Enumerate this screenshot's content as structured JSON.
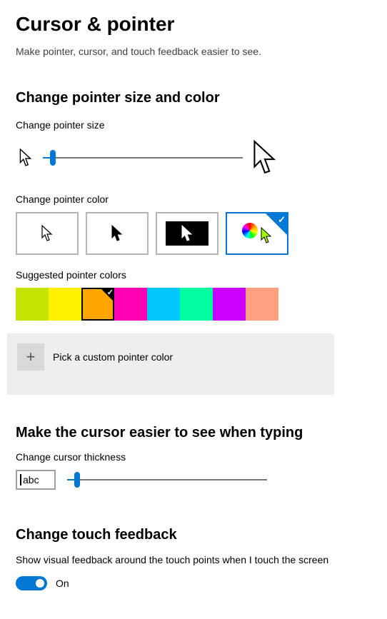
{
  "header": {
    "title": "Cursor & pointer",
    "subtitle": "Make pointer, cursor, and touch feedback easier to see."
  },
  "pointer_size_section": {
    "heading": "Change pointer size and color",
    "size_label": "Change pointer size",
    "slider_fill_percent": 5
  },
  "pointer_color": {
    "label": "Change pointer color",
    "options": [
      {
        "id": "white",
        "selected": false
      },
      {
        "id": "black",
        "selected": false
      },
      {
        "id": "inverted",
        "selected": false
      },
      {
        "id": "custom",
        "selected": true
      }
    ]
  },
  "suggested_colors": {
    "label": "Suggested pointer colors",
    "swatches": [
      {
        "hex": "#c4e400",
        "selected": false
      },
      {
        "hex": "#fff000",
        "selected": false
      },
      {
        "hex": "#ffa500",
        "selected": true
      },
      {
        "hex": "#ff00b4",
        "selected": false
      },
      {
        "hex": "#00c8ff",
        "selected": false
      },
      {
        "hex": "#00ffa0",
        "selected": false
      },
      {
        "hex": "#cc00ff",
        "selected": false
      },
      {
        "hex": "#ffa080",
        "selected": false
      }
    ]
  },
  "custom_color": {
    "button_label": "Pick a custom pointer color"
  },
  "cursor_section": {
    "heading": "Make the cursor easier to see when typing",
    "thickness_label": "Change cursor thickness",
    "sample_text": "abc",
    "slider_fill_percent": 5
  },
  "touch_section": {
    "heading": "Change touch feedback",
    "description": "Show visual feedback around the touch points when I touch the screen",
    "toggle_on": true,
    "toggle_state_label": "On"
  }
}
